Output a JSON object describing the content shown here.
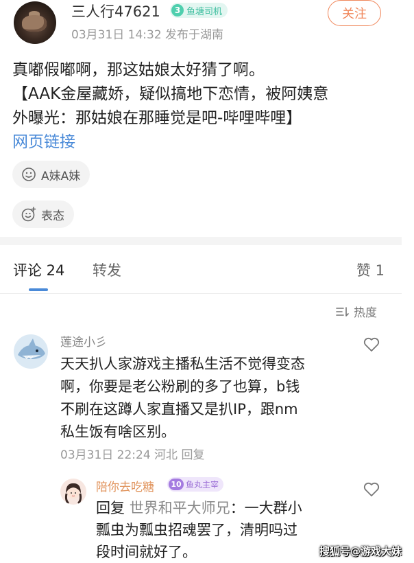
{
  "post": {
    "author": "三人行47621",
    "level": "3",
    "level_title": "鱼塘司机",
    "meta": "03月31日 14:32 发布于湖南",
    "follow_label": "关注",
    "text_lines": [
      "真嘟假嘟啊，那这姑娘太好猜了啊。",
      "【AAK金屋藏娇，疑似搞地下恋情，被阿姨意",
      "外曝光：那姑娘在那睡觉是吧-哔哩哔哩】"
    ],
    "link_label": "网页链接",
    "topic_chip": "A妹A妹",
    "emote_chip": "表态"
  },
  "tabs": {
    "comments": "评论 24",
    "repost": "转发",
    "likes": "赞 1"
  },
  "sort_label": "热度",
  "comments": [
    {
      "author": "莲途小彡",
      "text_lines": [
        "天天扒人家游戏主播私生活不觉得变态",
        "啊，你要是老公粉刷的多了也算，b钱",
        "不刷在这蹲人家直播又是扒IP，跟nm",
        "私生饭有啥区别。"
      ],
      "meta": "03月31日 22:24 河北 回复"
    }
  ],
  "reply": {
    "author": "陪你去吃糖",
    "level": "10",
    "level_title": "鱼丸主宰",
    "prefix": "回复",
    "target": "世界和平大师兄",
    "text_first": "：一大群小",
    "text_lines": [
      "瓢虫为瓢虫招魂罢了，清明吗过",
      "段时间就好了。"
    ]
  },
  "watermark": "搜狐号@游戏大妹",
  "colors": {
    "accent_orange": "#f0865a",
    "link_blue": "#4a8ad8",
    "teal_badge": "#4fcfae",
    "purple_badge": "#a47be0"
  }
}
